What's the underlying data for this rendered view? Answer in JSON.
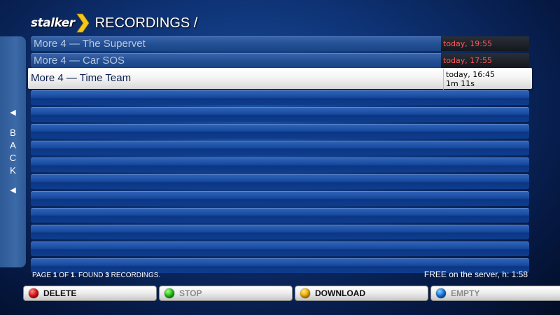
{
  "header": {
    "logo_text": "stalker",
    "title": "RECORDINGS /"
  },
  "back_panel": {
    "letters": [
      "B",
      "A",
      "C",
      "K"
    ]
  },
  "recordings": [
    {
      "title": "More 4 — The Supervet",
      "time": "today, 19:55"
    },
    {
      "title": "More 4 — Car SOS",
      "time": "today, 17:55"
    },
    {
      "title": "More 4 — Time Team",
      "time": "today, 16:45",
      "duration": "1m 11s"
    }
  ],
  "status": {
    "page_prefix": "PAGE ",
    "page_current": "1",
    "page_of": " OF ",
    "page_total": "1",
    "found_text": ". FOUND ",
    "found_count": "3",
    "found_suffix": " RECORDINGS.",
    "free_space": "FREE on the server, h: 1:58"
  },
  "buttons": {
    "delete": "DELETE",
    "stop": "STOP",
    "download": "DOWNLOAD",
    "empty": "EMPTY"
  },
  "colors": {
    "delete": "#e01a1a",
    "stop": "#29c61a",
    "download": "#f0b000",
    "empty": "#1a7ae0",
    "time_label": "#ff5a5a"
  }
}
